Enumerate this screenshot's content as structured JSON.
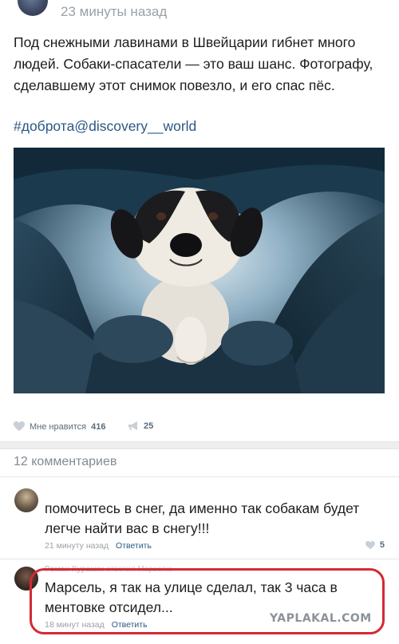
{
  "post": {
    "time": "23 минуты назад",
    "text": "Под снежными лавинами в Швейцарии гибнет много людей. Собаки-спасатели — это ваш шанс. Фотографу, сделавшему этот снимок повезло, и его спас пёс.",
    "hashtag": "#доброта@discovery__world",
    "like_label": "Мне нравится",
    "like_count": "416",
    "share_count": "25",
    "like_icon": "heart-icon",
    "share_icon": "megaphone-icon"
  },
  "comments": {
    "title": "12 комментариев",
    "items": [
      {
        "author": "",
        "text": "помочитесь в снег, да именно так собакам будет легче найти вас в снегу!!!",
        "time": "21 минуту назад",
        "reply_label": "Ответить",
        "likes": "5"
      },
      {
        "author": "Роман Куракин",
        "reply_to": "ответил Марселю",
        "text": "Марсель, я так на улице сделал, так 3 часа в ментовке отсидел...",
        "time": "18 минут назад",
        "reply_label": "Ответить"
      }
    ]
  },
  "watermark": "YAPLAKAL.COM",
  "colors": {
    "link": "#2a5885",
    "muted": "#9aa1a8",
    "highlight": "#d32a34",
    "divider": "#edeef0"
  }
}
